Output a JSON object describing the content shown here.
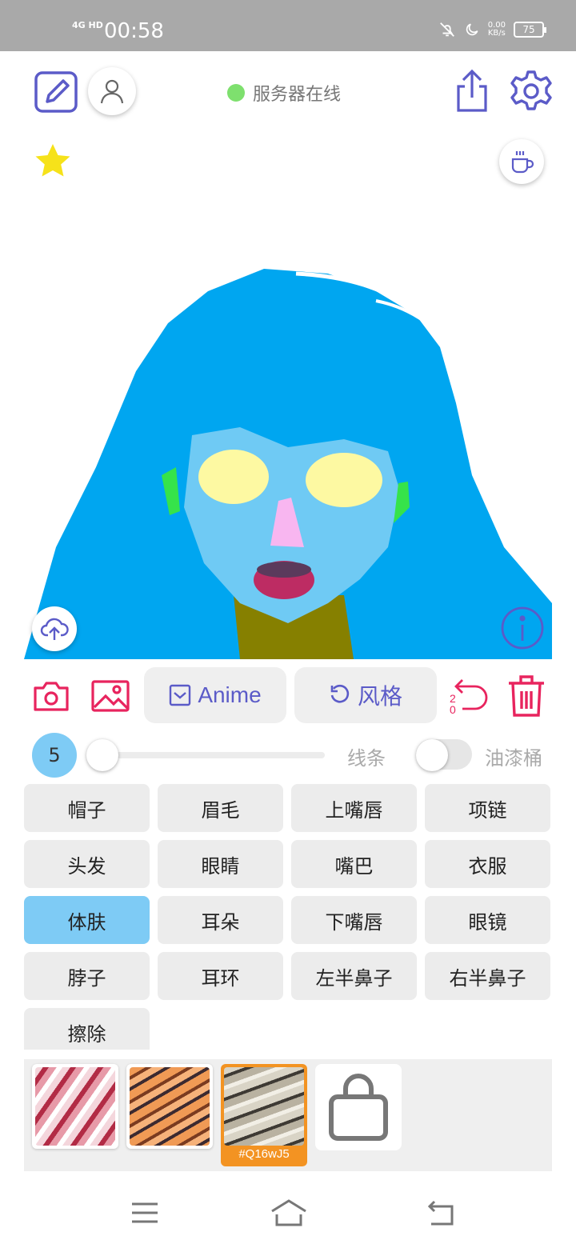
{
  "status_bar": {
    "network": "4G HD",
    "time": "00:58",
    "speed_value": "0.00",
    "speed_unit": "KB/s",
    "battery": "75"
  },
  "header": {
    "server_status": "服务器在线",
    "server_status_color": "#7ee06e"
  },
  "toolbar": {
    "style_label": "Anime",
    "reset_style_label": "风格",
    "undo_count": "20",
    "accent_color": "#e8245e",
    "brand_color": "#5b5bc8"
  },
  "brush": {
    "size": "5",
    "size_fraction": 0,
    "line_label": "线条",
    "bucket_label": "油漆桶",
    "bucket_enabled": false
  },
  "parts": [
    {
      "label": "帽子",
      "active": false
    },
    {
      "label": "眉毛",
      "active": false
    },
    {
      "label": "上嘴唇",
      "active": false
    },
    {
      "label": "项链",
      "active": false
    },
    {
      "label": "头发",
      "active": false
    },
    {
      "label": "眼睛",
      "active": false
    },
    {
      "label": "嘴巴",
      "active": false
    },
    {
      "label": "衣服",
      "active": false
    },
    {
      "label": "体肤",
      "active": true
    },
    {
      "label": "耳朵",
      "active": false
    },
    {
      "label": "下嘴唇",
      "active": false
    },
    {
      "label": "眼镜",
      "active": false
    },
    {
      "label": "脖子",
      "active": false
    },
    {
      "label": "耳环",
      "active": false
    },
    {
      "label": "左半鼻子",
      "active": false
    },
    {
      "label": "右半鼻子",
      "active": false
    },
    {
      "label": "擦除",
      "active": false
    }
  ],
  "styles": {
    "selected_code": "#Q16wJ5",
    "selected_color": "#f39322"
  },
  "icons": [
    "edit-icon",
    "user-icon",
    "share-icon",
    "settings-icon",
    "star-icon",
    "coffee-icon",
    "cloud-upload-icon",
    "info-icon",
    "camera-icon",
    "image-icon",
    "undo-icon",
    "trash-icon",
    "shopping-bag-icon",
    "menu-icon",
    "home-icon",
    "back-icon"
  ]
}
